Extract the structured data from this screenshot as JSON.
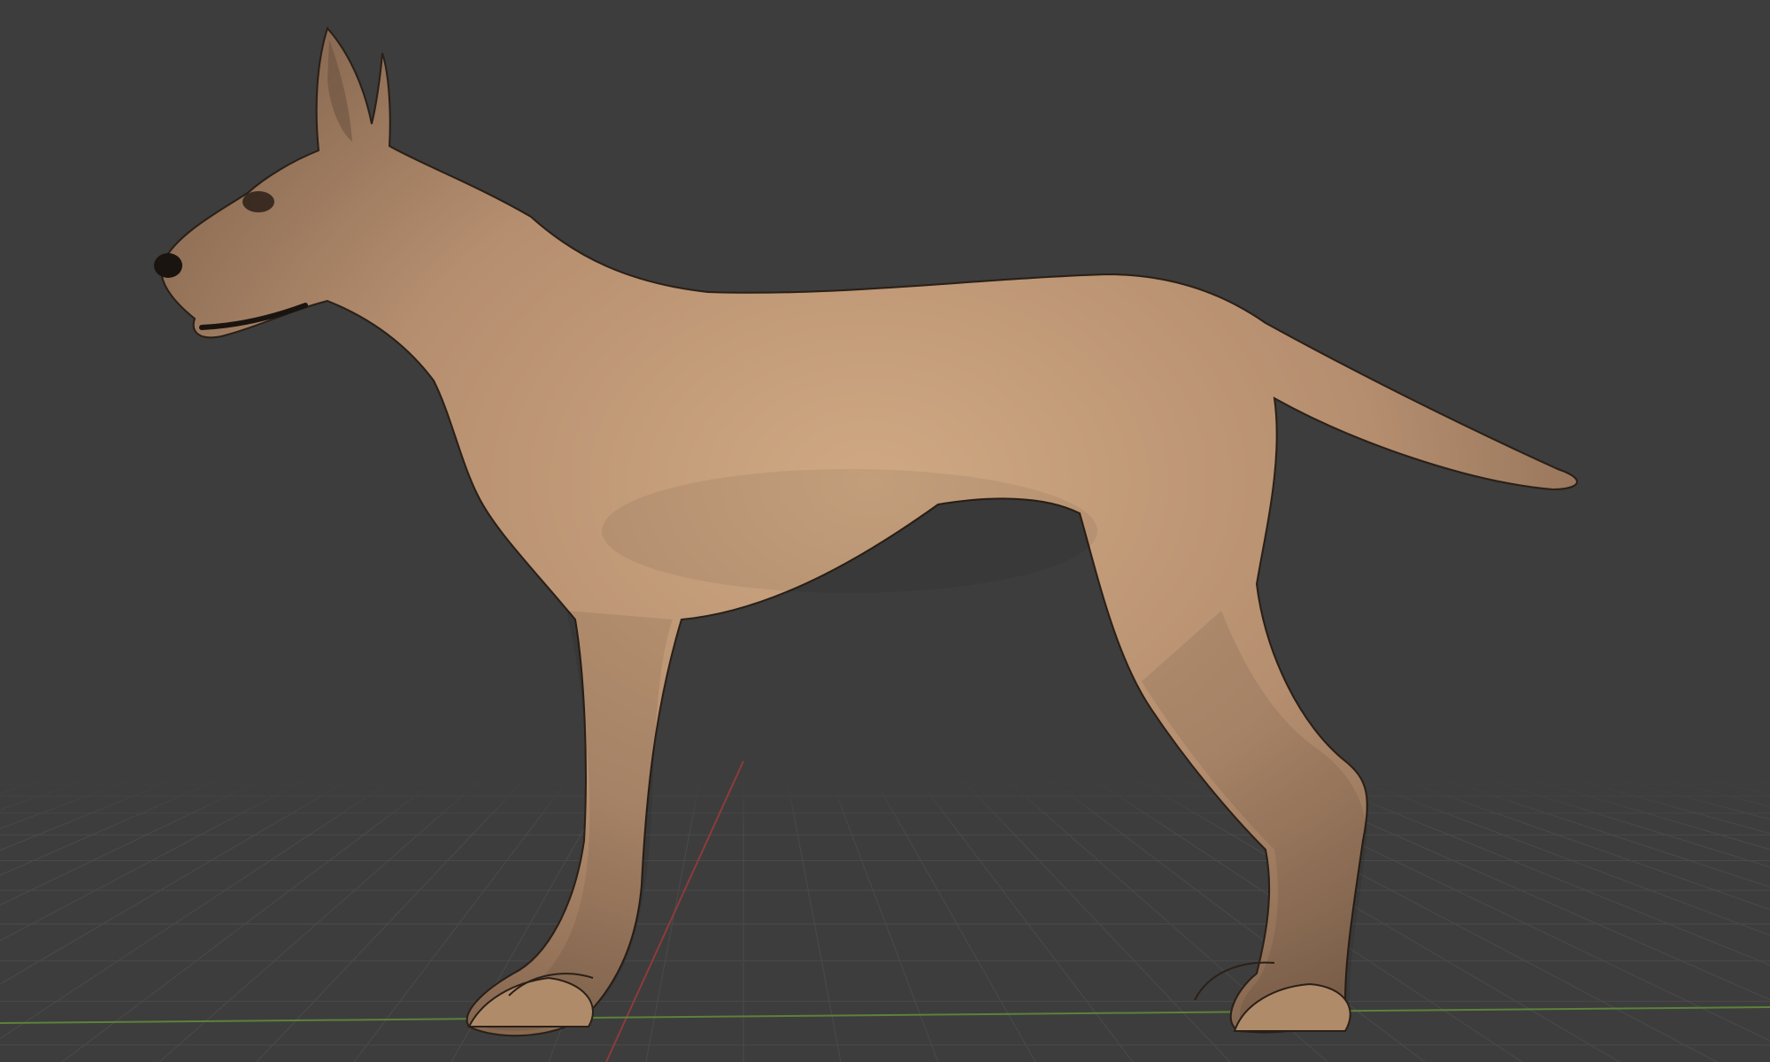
{
  "viewport": {
    "background": "#3d3d3d",
    "grid_color": "#4a4a4a",
    "x_axis_color": "#9b3b3b",
    "y_axis_color": "#5f8a3a"
  },
  "model": {
    "skin_light": "#c9a27e",
    "skin_mid": "#b28c6d",
    "skin_dark": "#7a5f49",
    "wire_color": "#1b1510",
    "nose_color": "#1a1410"
  }
}
